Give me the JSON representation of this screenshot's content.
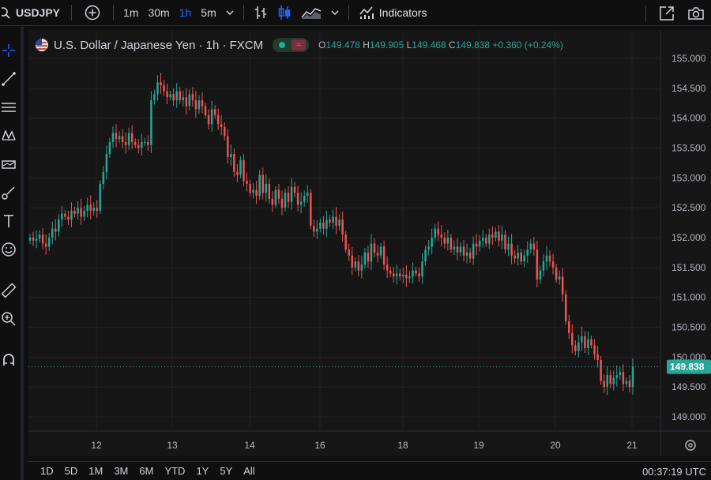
{
  "toolbar": {
    "symbol": "USDJPY",
    "intervals": [
      "1m",
      "30m",
      "1h",
      "5m"
    ],
    "active_interval": "1h",
    "indicators_label": "Indicators"
  },
  "legend": {
    "title": "U.S. Dollar / Japanese Yen · 1h · FXCM",
    "o_key": "O",
    "open": "149.478",
    "h_key": "H",
    "high": "149.905",
    "l_key": "L",
    "low": "149.468",
    "c_key": "C",
    "close": "149.838",
    "change": "+0.360 (+0.24%)"
  },
  "bottom": {
    "ranges": [
      "1D",
      "5D",
      "1M",
      "3M",
      "6M",
      "YTD",
      "1Y",
      "5Y",
      "All"
    ],
    "clock": "00:37:19 UTC"
  },
  "colors": {
    "up": "#26a69a",
    "down": "#ef5350",
    "background": "#161616",
    "accent": "#2962ff"
  },
  "left_tools": [
    "crosshair-icon",
    "trendline-icon",
    "fib-icon",
    "pattern-icon",
    "projection-icon",
    "brush-icon",
    "text-icon",
    "emoji-icon",
    "ruler-icon",
    "zoom-icon",
    "magnet-icon"
  ],
  "chart_data": {
    "type": "candlestick",
    "symbol": "USDJPY",
    "interval": "1h",
    "x_tick_labels": [
      "12",
      "13",
      "14",
      "16",
      "18",
      "19",
      "20",
      "21"
    ],
    "y_tick_labels": [
      "149.000",
      "149.500",
      "150.000",
      "150.500",
      "151.000",
      "151.500",
      "152.000",
      "152.500",
      "153.000",
      "153.500",
      "154.000",
      "154.500",
      "155.000"
    ],
    "ylim": [
      148.8,
      155.15
    ],
    "last_price_label": "149.838",
    "closes": [
      152.0,
      151.95,
      151.98,
      152.05,
      151.9,
      151.85,
      152.0,
      152.15,
      152.1,
      152.3,
      152.4,
      152.35,
      152.3,
      152.45,
      152.4,
      152.5,
      152.35,
      152.45,
      152.55,
      152.45,
      152.5,
      152.45,
      152.9,
      153.1,
      153.4,
      153.6,
      153.75,
      153.65,
      153.7,
      153.6,
      153.55,
      153.75,
      153.6,
      153.55,
      153.5,
      153.6,
      153.6,
      153.55,
      154.3,
      154.4,
      154.6,
      154.55,
      154.45,
      154.35,
      154.4,
      154.3,
      154.45,
      154.3,
      154.35,
      154.2,
      154.4,
      154.3,
      154.15,
      154.3,
      154.2,
      154.05,
      153.9,
      154.15,
      154.05,
      153.9,
      153.85,
      153.7,
      153.35,
      153.4,
      153.1,
      153.05,
      153.3,
      152.95,
      152.9,
      152.75,
      152.8,
      152.7,
      153.05,
      152.75,
      152.9,
      152.65,
      152.55,
      152.8,
      152.65,
      152.5,
      152.75,
      152.6,
      152.85,
      152.75,
      152.55,
      152.6,
      152.7,
      152.75,
      152.2,
      152.1,
      152.15,
      152.25,
      152.15,
      152.3,
      152.25,
      152.35,
      152.2,
      152.3,
      152.05,
      151.8,
      151.7,
      151.5,
      151.6,
      151.45,
      151.55,
      151.75,
      151.6,
      151.9,
      151.75,
      151.7,
      151.85,
      151.55,
      151.45,
      151.4,
      151.35,
      151.4,
      151.35,
      151.38,
      151.32,
      151.35,
      151.45,
      151.4,
      151.35,
      151.6,
      151.8,
      151.85,
      152.0,
      152.15,
      152.05,
      152.0,
      151.9,
      152.0,
      151.8,
      151.85,
      151.75,
      151.85,
      151.7,
      151.75,
      151.65,
      151.9,
      151.85,
      151.95,
      152.0,
      151.9,
      152.05,
      152.0,
      152.1,
      151.95,
      152.05,
      151.8,
      151.9,
      151.7,
      151.65,
      151.75,
      151.6,
      151.7,
      151.8,
      151.9,
      151.8,
      151.3,
      151.45,
      151.6,
      151.7,
      151.6,
      151.5,
      151.3,
      151.35,
      151.05,
      150.6,
      150.4,
      150.2,
      150.1,
      150.25,
      150.35,
      150.15,
      150.3,
      150.2,
      150.05,
      149.95,
      149.6,
      149.5,
      149.7,
      149.55,
      149.65,
      149.7,
      149.75,
      149.55,
      149.6,
      149.5,
      149.838
    ]
  }
}
